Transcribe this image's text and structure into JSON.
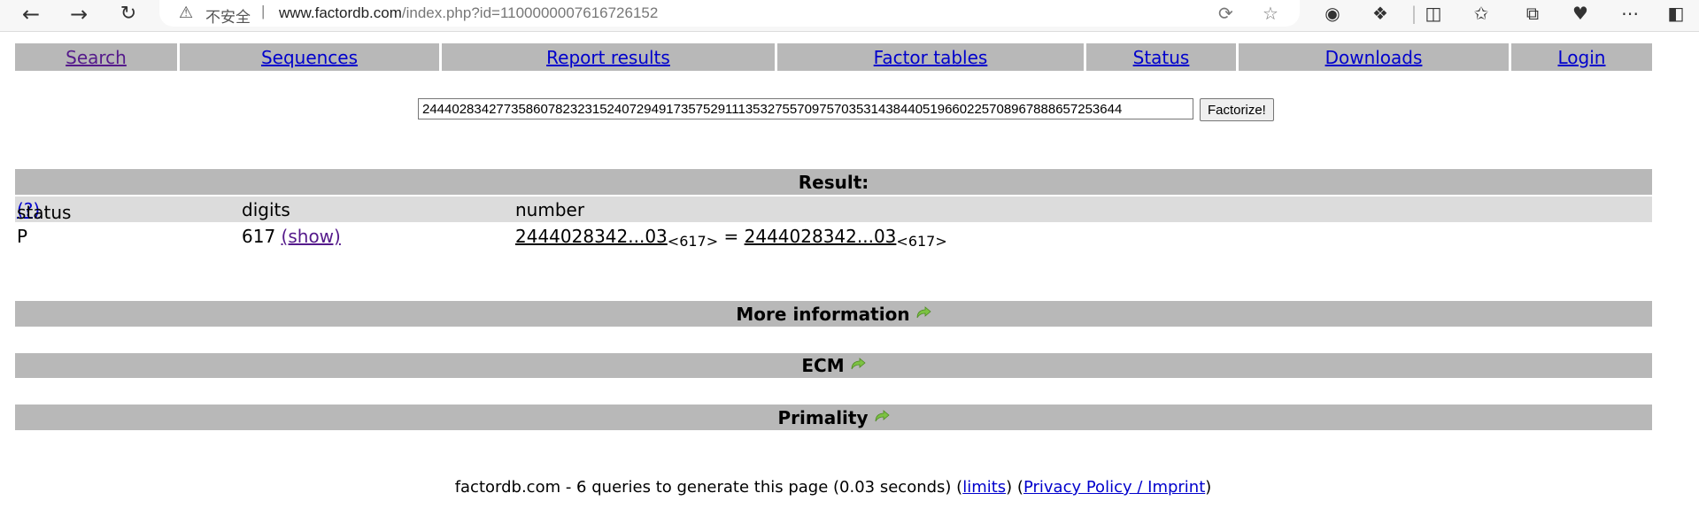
{
  "browser": {
    "insecure_label": "不安全",
    "separator": "|",
    "url_host": "www.factordb.com",
    "url_path": "/index.php?id=1100000007616726152"
  },
  "menu": [
    {
      "label": "Search",
      "visited": true
    },
    {
      "label": "Sequences",
      "visited": false
    },
    {
      "label": "Report results",
      "visited": false
    },
    {
      "label": "Factor tables",
      "visited": false
    },
    {
      "label": "Status",
      "visited": false
    },
    {
      "label": "Downloads",
      "visited": false
    },
    {
      "label": "Login",
      "visited": false
    }
  ],
  "search": {
    "value": "24440283427735860782323152407294917357529111353275570975703531438440519660225708967888657253644",
    "button_label": "Factorize!"
  },
  "result": {
    "title": "Result:",
    "columns": {
      "status": "status",
      "status_help": "(?)",
      "digits": "digits",
      "number": "number"
    },
    "row": {
      "status": "P",
      "digits": "617",
      "show_label": "(show)",
      "number_left": "2444028342...03",
      "number_left_digits": "<617>",
      "equals": "=",
      "number_right": "2444028342...03",
      "number_right_digits": "<617>"
    }
  },
  "sections": {
    "more_info": "More information",
    "ecm": "ECM",
    "primality": "Primality"
  },
  "footer": {
    "text": "factordb.com - 6 queries to generate this page (0.03 seconds) (",
    "limits": "limits",
    "mid": ") (",
    "privacy": "Privacy Policy / Imprint",
    "end": ")"
  },
  "colors": {
    "band": "#b8b8b8",
    "header_row": "#dcdcdc",
    "link": "#0000cc",
    "visited": "#551a8b",
    "arrow_green": "#7cc242"
  }
}
